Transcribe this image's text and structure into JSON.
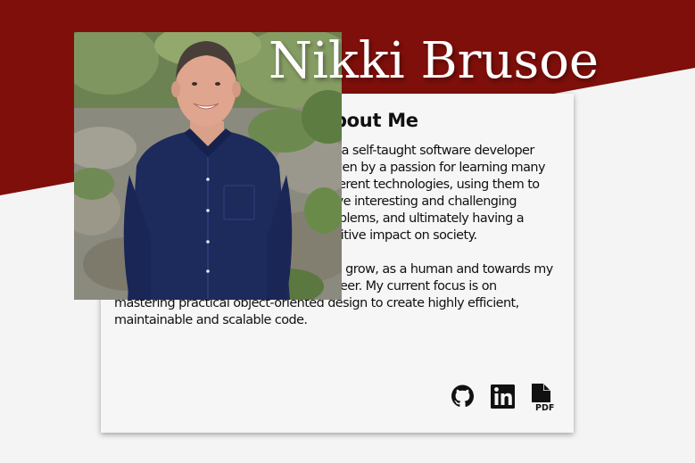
{
  "header": {
    "name": "Nikki Brusoe"
  },
  "about": {
    "title": "About Me",
    "paragraphs": [
      "I'm a self-taught software developer driven by a passion for learning many different technologies, using them to solve interesting and challenging problems, and ultimately having a positive impact on society.",
      "I'm always looking for opportunities to grow, as a human and towards my goal of becoming a high-quality engineer. My current focus is on mastering practical object-oriented design to create highly efficient, maintainable and scalable code."
    ]
  },
  "social": {
    "icons": [
      "github-icon",
      "linkedin-icon",
      "pdf-resume-icon"
    ],
    "pdf_badge": "PDF"
  },
  "colors": {
    "banner": "#7e0f0a",
    "background": "#f4f4f4",
    "card": "#f6f6f6",
    "text": "#111111",
    "heading": "#ffffff",
    "shirt": "#1d2a5c"
  }
}
